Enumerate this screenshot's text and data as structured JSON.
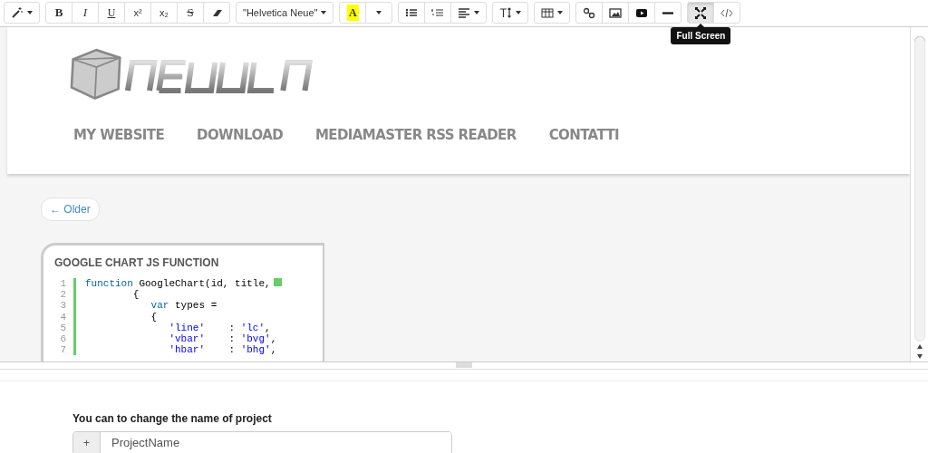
{
  "toolbar": {
    "groups": [
      {
        "buttons": [
          {
            "kind": "wand",
            "caret": true,
            "selected": false
          }
        ]
      },
      {
        "buttons": [
          {
            "kind": "bold",
            "label": "B",
            "selected": false
          },
          {
            "kind": "italic",
            "label": "I",
            "selected": false
          },
          {
            "kind": "underline",
            "label": "U",
            "selected": false
          },
          {
            "kind": "superscript",
            "label": "x²",
            "selected": false
          },
          {
            "kind": "subscript",
            "label": "x₂",
            "selected": false
          },
          {
            "kind": "strike",
            "label": "S",
            "selected": false
          },
          {
            "kind": "eraser",
            "selected": false
          }
        ]
      },
      {
        "buttons": [
          {
            "kind": "font",
            "label": "\"Helvetica Neue\"",
            "caret": true,
            "selected": false
          }
        ]
      },
      {
        "buttons": [
          {
            "kind": "color",
            "label": "A",
            "selected": false
          },
          {
            "kind": "caret",
            "caret": true,
            "selected": false
          }
        ]
      },
      {
        "buttons": [
          {
            "kind": "bullets",
            "selected": false
          },
          {
            "kind": "numbers",
            "selected": false
          },
          {
            "kind": "align",
            "caret": true,
            "selected": false
          }
        ]
      },
      {
        "buttons": [
          {
            "kind": "height",
            "caret": true,
            "selected": false
          }
        ]
      },
      {
        "buttons": [
          {
            "kind": "table",
            "caret": true,
            "selected": false
          }
        ]
      },
      {
        "buttons": [
          {
            "kind": "link",
            "selected": false
          },
          {
            "kind": "picture",
            "selected": false
          },
          {
            "kind": "video",
            "selected": false
          },
          {
            "kind": "rule",
            "selected": false
          }
        ]
      },
      {
        "buttons": [
          {
            "kind": "fullscreen",
            "selected": true,
            "tooltip": "Full Screen"
          },
          {
            "kind": "code",
            "selected": false
          }
        ]
      }
    ]
  },
  "site": {
    "menu": [
      "MY WEBSITE",
      "DOWNLOAD",
      "MEDIAMASTER RSS READER",
      "CONTATTI"
    ],
    "older": "← Older",
    "snippet": {
      "title": "GOOGLE CHART JS FUNCTION",
      "lines": [
        {
          "number": "1",
          "parts": [
            {
              "kind": "keyword",
              "text": "function"
            },
            {
              "kind": "plain",
              "text": " GoogleChart(id, title,"
            }
          ],
          "more": true
        },
        {
          "number": "2",
          "parts": [
            {
              "kind": "plain",
              "text": "        {"
            }
          ],
          "more": false
        },
        {
          "number": "3",
          "parts": [
            {
              "kind": "keyword",
              "text": "           var"
            },
            {
              "kind": "plain",
              "text": " types ="
            }
          ],
          "more": false
        },
        {
          "number": "4",
          "parts": [
            {
              "kind": "plain",
              "text": "           {"
            }
          ],
          "more": false
        },
        {
          "number": "5",
          "parts": [
            {
              "kind": "string",
              "text": "              'line'"
            },
            {
              "kind": "plain",
              "text": "    : "
            },
            {
              "kind": "string",
              "text": "'lc'"
            },
            {
              "kind": "plain",
              "text": ","
            }
          ],
          "more": false
        },
        {
          "number": "6",
          "parts": [
            {
              "kind": "string",
              "text": "              'vbar'"
            },
            {
              "kind": "plain",
              "text": "    : "
            },
            {
              "kind": "string",
              "text": "'bvg'"
            },
            {
              "kind": "plain",
              "text": ","
            }
          ],
          "more": false
        },
        {
          "number": "7",
          "parts": [
            {
              "kind": "string",
              "text": "              'hbar'"
            },
            {
              "kind": "plain",
              "text": "    : "
            },
            {
              "kind": "string",
              "text": "'bhg'"
            },
            {
              "kind": "plain",
              "text": ","
            }
          ],
          "more": false
        }
      ]
    }
  },
  "form": {
    "label": "You can to change the name of project",
    "addon": "+",
    "value": "ProjectName"
  }
}
